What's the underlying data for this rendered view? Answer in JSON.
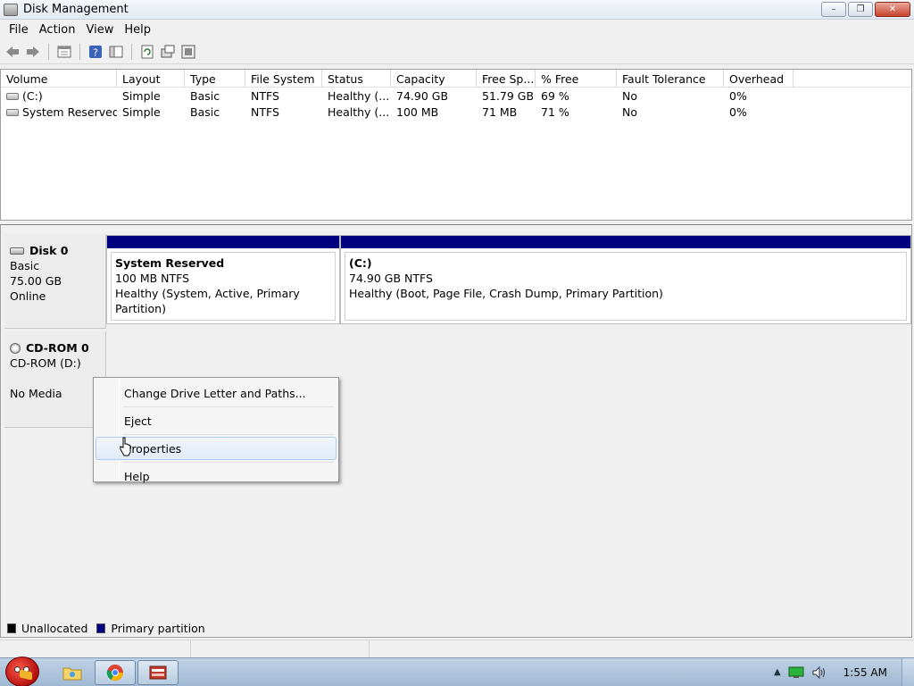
{
  "window": {
    "title": "Disk Management",
    "buttons": {
      "minimize": "–",
      "maximize": "❐",
      "close": "✕"
    }
  },
  "menubar": {
    "items": [
      "File",
      "Action",
      "View",
      "Help"
    ]
  },
  "toolbar": {
    "icons": [
      "back-icon",
      "forward-icon",
      "properties-icon",
      "help-icon",
      "show-hide-icon",
      "refresh-icon",
      "rescan-icon",
      "settings-icon"
    ]
  },
  "volume_list": {
    "columns": [
      "Volume",
      "Layout",
      "Type",
      "File System",
      "Status",
      "Capacity",
      "Free Sp...",
      "% Free",
      "Fault Tolerance",
      "Overhead"
    ],
    "rows": [
      [
        "(C:)",
        "Simple",
        "Basic",
        "NTFS",
        "Healthy (...",
        "74.90 GB",
        "51.79 GB",
        "69 %",
        "No",
        "0%"
      ],
      [
        "System Reserved",
        "Simple",
        "Basic",
        "NTFS",
        "Healthy (...",
        "100 MB",
        "71 MB",
        "71 %",
        "No",
        "0%"
      ]
    ]
  },
  "disks": {
    "disk0": {
      "name": "Disk 0",
      "type": "Basic",
      "size": "75.00 GB",
      "status": "Online",
      "partitions": [
        {
          "name": "System Reserved",
          "size_fs": "100 MB NTFS",
          "status": "Healthy (System, Active, Primary Partition)"
        },
        {
          "name": "(C:)",
          "size_fs": "74.90 GB NTFS",
          "status": "Healthy (Boot, Page File, Crash Dump, Primary Partition)"
        }
      ]
    },
    "cdrom0": {
      "name": "CD-ROM 0",
      "drive": "CD-ROM (D:)",
      "media": "No Media"
    }
  },
  "legend": {
    "items": [
      {
        "label": "Unallocated",
        "color": "#000000"
      },
      {
        "label": "Primary partition",
        "color": "#000080"
      }
    ]
  },
  "context_menu": {
    "items": [
      "Change Drive Letter and Paths...",
      "Eject",
      "Properties",
      "Help"
    ],
    "hovered": "Properties"
  },
  "taskbar": {
    "apps": [
      "explorer-icon",
      "chrome-icon",
      "disk-management-icon"
    ],
    "tray_icons": [
      "show-hidden-icons-icon",
      "network-icon",
      "volume-icon"
    ],
    "clock": "1:55 AM"
  }
}
